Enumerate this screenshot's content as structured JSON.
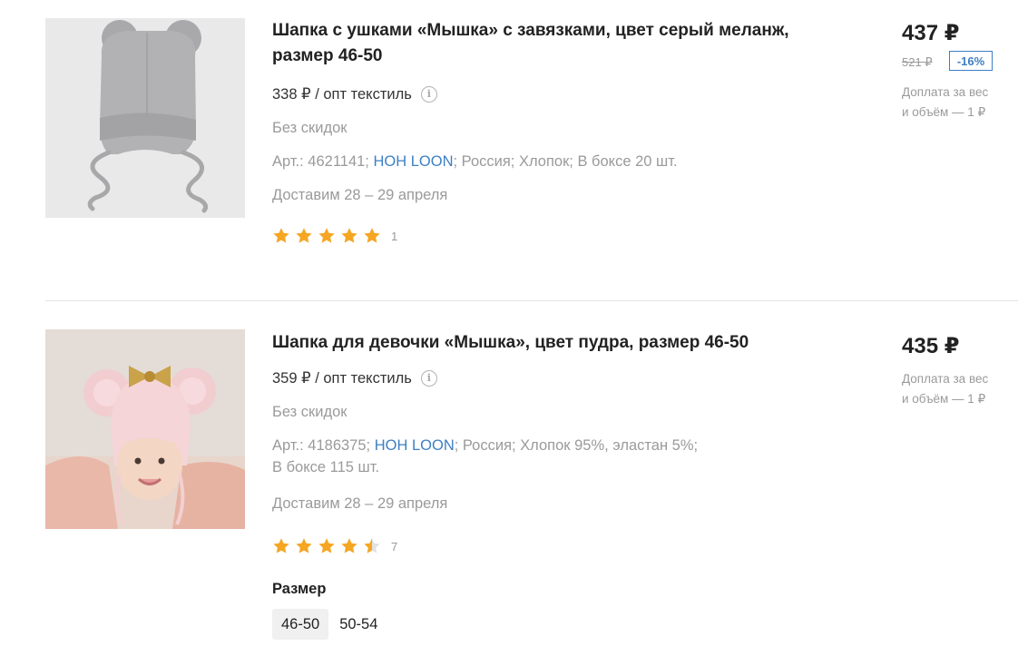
{
  "products": [
    {
      "title": "Шапка с ушками «Мышка» с завязками, цвет серый меланж, размер 46-50",
      "wholesale": "338 ₽ / опт текстиль",
      "discount_note": "Без скидок",
      "article_prefix": "Арт.: 4621141;",
      "brand": "HOH LOON",
      "article_suffix": "; Россия; Хлопок; В боксе 20 шт.",
      "delivery": "Доставим 28 – 29 апреля",
      "rating": 5,
      "reviews": "1",
      "price": "437 ₽",
      "old_price": "521 ₽",
      "discount": "-16%",
      "surcharge_line1": "Доплата за вес",
      "surcharge_line2": "и объём — 1 ₽",
      "image_icon": "grey-mouse-ear-hat"
    },
    {
      "title": "Шапка для девочки «Мышка», цвет пудра, размер 46-50",
      "wholesale": "359 ₽ / опт текстиль",
      "discount_note": "Без скидок",
      "article_prefix": "Арт.: 4186375;",
      "brand": "HOH LOON",
      "article_suffix": "; Россия; Хлопок 95%, эластан 5%;",
      "article_line2": "В боксе 115 шт.",
      "delivery": "Доставим 28 – 29 апреля",
      "rating": 4.5,
      "reviews": "7",
      "price": "435 ₽",
      "surcharge_line1": "Доплата за вес",
      "surcharge_line2": "и объём — 1 ₽",
      "size_label": "Размер",
      "sizes": [
        "46-50",
        "50-54"
      ],
      "selected_size": "46-50",
      "image_icon": "baby-in-pink-mouse-hat"
    }
  ],
  "colors": {
    "link": "#3d7fc4",
    "muted": "#9a9a9a",
    "star": "#f5a623"
  }
}
